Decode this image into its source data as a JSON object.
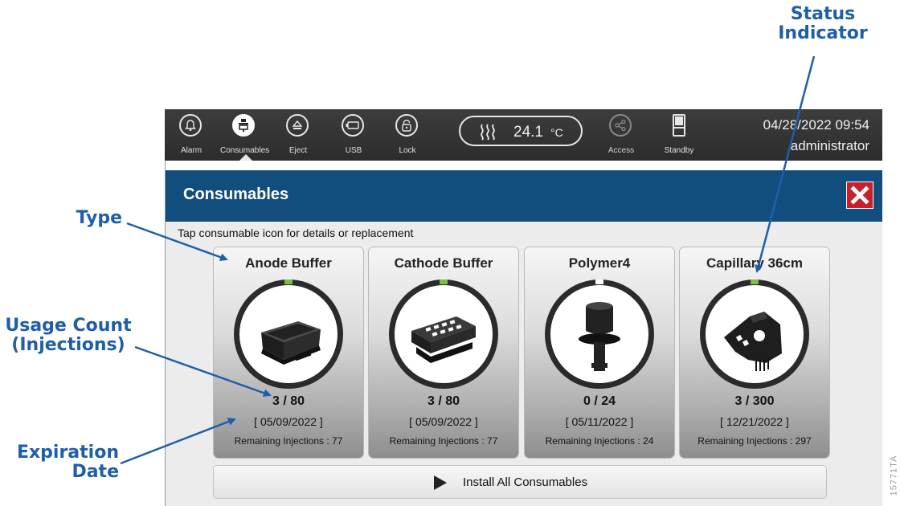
{
  "annotations": {
    "status_indicator": "Status\nIndicator",
    "type": "Type",
    "usage_count": "Usage Count\n(Injections)",
    "expiration_date": "Expiration\nDate",
    "figure_id": "15771TA",
    "color": "#1f5ea9"
  },
  "topbar": {
    "buttons": [
      {
        "label": "Alarm",
        "icon": "bell-icon"
      },
      {
        "label": "Consumables",
        "icon": "consumables-icon",
        "active": true
      },
      {
        "label": "Eject",
        "icon": "eject-icon"
      },
      {
        "label": "USB",
        "icon": "usb-icon"
      },
      {
        "label": "Lock",
        "icon": "lock-icon"
      }
    ],
    "temperature": {
      "value": "24.1",
      "unit": "°C",
      "icon": "heat-waves-icon"
    },
    "access": {
      "label": "Access",
      "icon": "share-icon",
      "disabled": true
    },
    "standby": {
      "label": "Standby",
      "icon": "standby-icon"
    },
    "datetime": "04/28/2022 09:54",
    "user": "administrator"
  },
  "dialog": {
    "title": "Consumables",
    "close_icon": "close-icon",
    "instruction": "Tap consumable icon for details or replacement",
    "cards": [
      {
        "name": "Anode Buffer",
        "usage": "3 / 80",
        "expiration": "[ 05/09/2022 ]",
        "remaining": "Remaining Injections : 77",
        "icon": "anode-buffer-icon",
        "status_color": "#7ac143"
      },
      {
        "name": "Cathode Buffer",
        "usage": "3 / 80",
        "expiration": "[ 05/09/2022 ]",
        "remaining": "Remaining Injections : 77",
        "icon": "cathode-buffer-icon",
        "status_color": "#7ac143"
      },
      {
        "name": "Polymer4",
        "usage": "0 / 24",
        "expiration": "[ 05/11/2022 ]",
        "remaining": "Remaining Injections : 24",
        "icon": "polymer-pouch-icon",
        "status_color": "#ffffff"
      },
      {
        "name": "Capillary 36cm",
        "usage": "3 / 300",
        "expiration": "[ 12/21/2022 ]",
        "remaining": "Remaining Injections : 297",
        "icon": "capillary-array-icon",
        "status_color": "#7ac143"
      }
    ],
    "install_button": {
      "label": "Install All Consumables",
      "icon": "play-icon"
    }
  },
  "colors": {
    "header_blue": "#114d7d",
    "close_red": "#c8202b",
    "status_green": "#7ac143"
  }
}
